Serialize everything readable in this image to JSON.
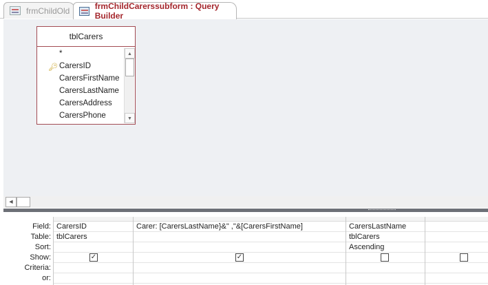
{
  "tabs": [
    {
      "label": "frmChildOld",
      "active": false
    },
    {
      "label": "frmChildCarerssubform : Query Builder",
      "active": true
    }
  ],
  "table": {
    "title": "tblCarers",
    "fields": [
      "*",
      "CarersID",
      "CarersFirstName",
      "CarersLastName",
      "CarersAddress",
      "CarersPhone"
    ],
    "primary_key": "CarersID"
  },
  "grid": {
    "row_labels": [
      "Field:",
      "Table:",
      "Sort:",
      "Show:",
      "Criteria:",
      "or:"
    ],
    "columns": [
      {
        "field": "CarersID",
        "table": "tblCarers",
        "sort": "",
        "show": true
      },
      {
        "field": "Carer: [CarersLastName}&\" ,\"&[CarersFirstName]",
        "table": "",
        "sort": "",
        "show": true
      },
      {
        "field": "CarersLastName",
        "table": "tblCarers",
        "sort": "Ascending",
        "show": false
      },
      {
        "field": "",
        "table": "",
        "sort": "",
        "show": false
      }
    ]
  },
  "icons": {
    "check": "✓",
    "key": "key-icon"
  }
}
